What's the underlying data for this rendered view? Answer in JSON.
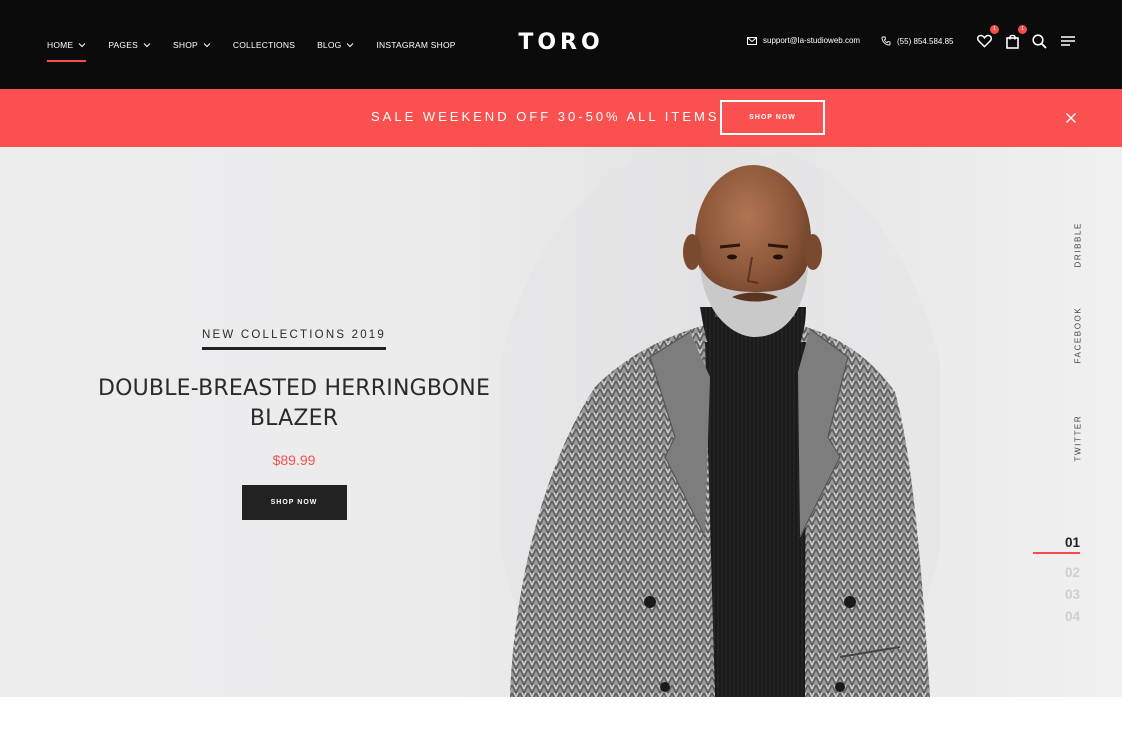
{
  "header": {
    "nav": [
      {
        "label": "HOME",
        "has_dropdown": true,
        "active": true
      },
      {
        "label": "PAGES",
        "has_dropdown": true
      },
      {
        "label": "SHOP",
        "has_dropdown": true
      },
      {
        "label": "COLLECTIONS",
        "has_dropdown": false
      },
      {
        "label": "BLOG",
        "has_dropdown": true
      },
      {
        "label": "INSTAGRAM SHOP",
        "has_dropdown": false
      }
    ],
    "logo": "TORO",
    "email": "support@la-studioweb.com",
    "phone": "(55) 854.584.85",
    "wishlist_count": "1",
    "cart_count": "1",
    "icons": [
      "mail-icon",
      "phone-icon",
      "heart-icon",
      "bag-icon",
      "search-icon",
      "menu-icon"
    ]
  },
  "promo": {
    "text": "SALE WEEKEND OFF 30-50% ALL ITEMS",
    "button_label": "SHOP NOW",
    "close_icon": "close-icon"
  },
  "hero": {
    "eyebrow": "NEW COLLECTIONS 2019",
    "title_line1": "DOUBLE-BREASTED HERRINGBONE",
    "title_line2": "BLAZER",
    "price": "$89.99",
    "button_label": "SHOP NOW",
    "social": [
      "DRIBBLE",
      "FACEBOOK",
      "TWITTER"
    ],
    "slides": [
      "01",
      "02",
      "03",
      "04"
    ],
    "active_slide": "01"
  },
  "colors": {
    "header_bg": "#0b0b0c",
    "accent": "#f44d4d",
    "promo_bg": "#fa5050",
    "hero_bg": "#ececed",
    "dark_button": "#222222"
  }
}
